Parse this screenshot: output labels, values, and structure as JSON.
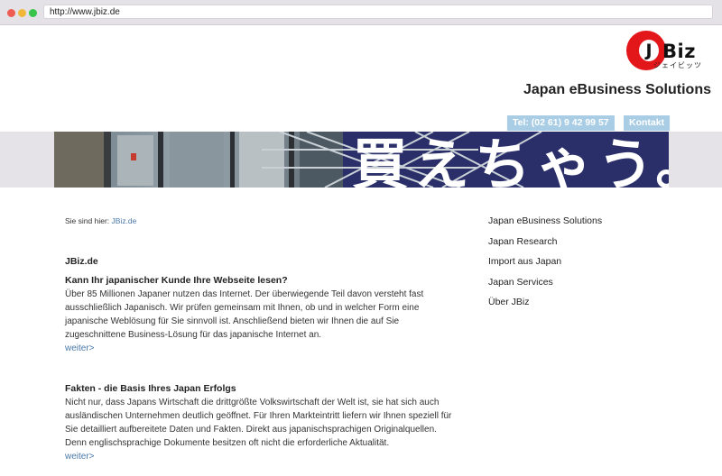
{
  "browser": {
    "url": "http://www.jbiz.de"
  },
  "header": {
    "logo": {
      "letter": "J",
      "text": "Biz",
      "kana": "ジェイビッツ"
    },
    "title": "Japan eBusiness Solutions",
    "phone": "Tel: (02 61) 9 42 99 57",
    "contact": "Kontakt"
  },
  "breadcrumb": {
    "label": "Sie sind hier:",
    "link": "JBiz.de"
  },
  "main": {
    "heading": "JBiz.de",
    "sections": [
      {
        "title": "Kann Ihr japanischer Kunde Ihre Webseite lesen?",
        "body": "Über 85 Millionen Japaner nutzen das Internet. Der überwiegende Teil davon versteht fast ausschließlich Japanisch. Wir prüfen gemeinsam mit Ihnen, ob und in welcher Form eine japanische Weblösung für Sie sinnvoll ist. Anschließend bieten wir Ihnen die auf Sie zugeschnittene Business-Lösung für das japanische Internet an.",
        "more": "weiter>"
      },
      {
        "title": "Fakten - die Basis Ihres Japan Erfolgs",
        "body": "Nicht nur, dass Japans Wirtschaft die drittgrößte Volkswirtschaft der Welt ist, sie hat sich auch ausländischen Unternehmen deutlich geöffnet. Für Ihren Markteintritt liefern wir Ihnen speziell für Sie detailliert aufbereitete Daten und Fakten. Direkt aus japanischsprachigen Originalquellen. Denn englischsprachige Dokumente besitzen oft nicht die erforderliche Aktualität.",
        "more": "weiter>"
      }
    ]
  },
  "sidebar": {
    "items": [
      {
        "label": "Japan eBusiness Solutions"
      },
      {
        "label": "Japan Research"
      },
      {
        "label": "Import aus Japan"
      },
      {
        "label": "Japan Services"
      },
      {
        "label": "Über JBiz"
      }
    ]
  },
  "colors": {
    "accent_red": "#e3161a",
    "pill_blue": "#a9cde5",
    "link_blue": "#4a78a8",
    "banner_navy": "#2a2f6a"
  },
  "banner": {
    "kana": "買えちゃう。"
  }
}
